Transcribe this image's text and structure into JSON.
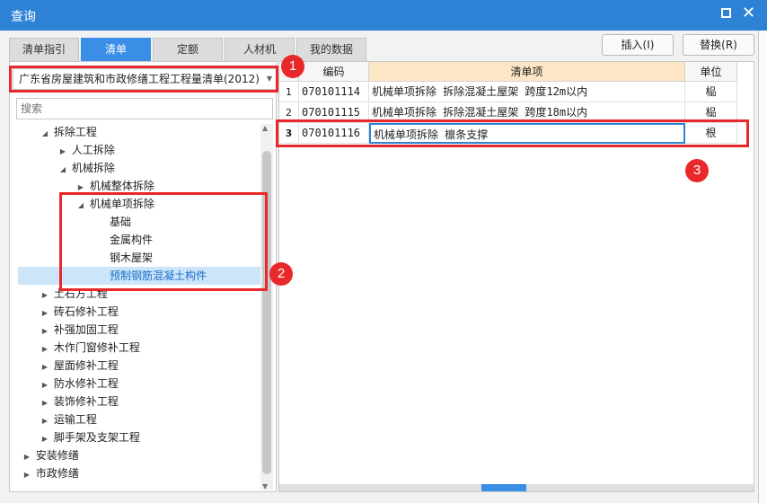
{
  "window": {
    "title": "查询"
  },
  "tabs": [
    {
      "label": "清单指引"
    },
    {
      "label": "清单"
    },
    {
      "label": "定额"
    },
    {
      "label": "人材机"
    },
    {
      "label": "我的数据"
    }
  ],
  "buttons": {
    "insert": "插入(I)",
    "replace": "替换(R)"
  },
  "library": {
    "selected": "广东省房屋建筑和市政修缮工程工程量清单(2012)"
  },
  "search": {
    "placeholder": "搜索"
  },
  "tree": [
    {
      "label": "拆除工程",
      "expanded": true
    },
    {
      "label": "人工拆除",
      "expanded": false
    },
    {
      "label": "机械拆除",
      "expanded": true
    },
    {
      "label": "机械整体拆除",
      "expanded": false
    },
    {
      "label": "机械单项拆除",
      "expanded": true
    },
    {
      "label": "基础"
    },
    {
      "label": "金属构件"
    },
    {
      "label": "钢木屋架"
    },
    {
      "label": "预制钢筋混凝土构件",
      "selected": true
    },
    {
      "label": "土石方工程",
      "expanded": false
    },
    {
      "label": "砖石修补工程",
      "expanded": false
    },
    {
      "label": "补强加固工程",
      "expanded": false
    },
    {
      "label": "木作门窗修补工程",
      "expanded": false
    },
    {
      "label": "屋面修补工程",
      "expanded": false
    },
    {
      "label": "防水修补工程",
      "expanded": false
    },
    {
      "label": "装饰修补工程",
      "expanded": false
    },
    {
      "label": "运输工程",
      "expanded": false
    },
    {
      "label": "脚手架及支架工程",
      "expanded": false
    },
    {
      "label": "安装修缮",
      "expanded": false
    },
    {
      "label": "市政修缮",
      "expanded": false
    }
  ],
  "table": {
    "columns": [
      "编码",
      "清单项",
      "单位"
    ],
    "rows": [
      {
        "num": "1",
        "code": "070101114",
        "name": "机械单项拆除 拆除混凝土屋架 跨度12m以内",
        "unit": "榀"
      },
      {
        "num": "2",
        "code": "070101115",
        "name": "机械单项拆除 拆除混凝土屋架 跨度18m以内",
        "unit": "榀"
      },
      {
        "num": "3",
        "code": "070101116",
        "name": "机械单项拆除 檩条支撑",
        "unit": "根"
      }
    ]
  },
  "annotations": [
    "1",
    "2",
    "3"
  ],
  "colors": {
    "accent": "#2e82d6",
    "annotation": "#e8282b",
    "selected_row": "#cce5f9"
  },
  "icons": {
    "maximize": "maximize-icon",
    "close": "close-icon",
    "dropdown": "caret-down-icon",
    "expand": "triangle-right-icon",
    "collapse": "triangle-down-icon"
  }
}
